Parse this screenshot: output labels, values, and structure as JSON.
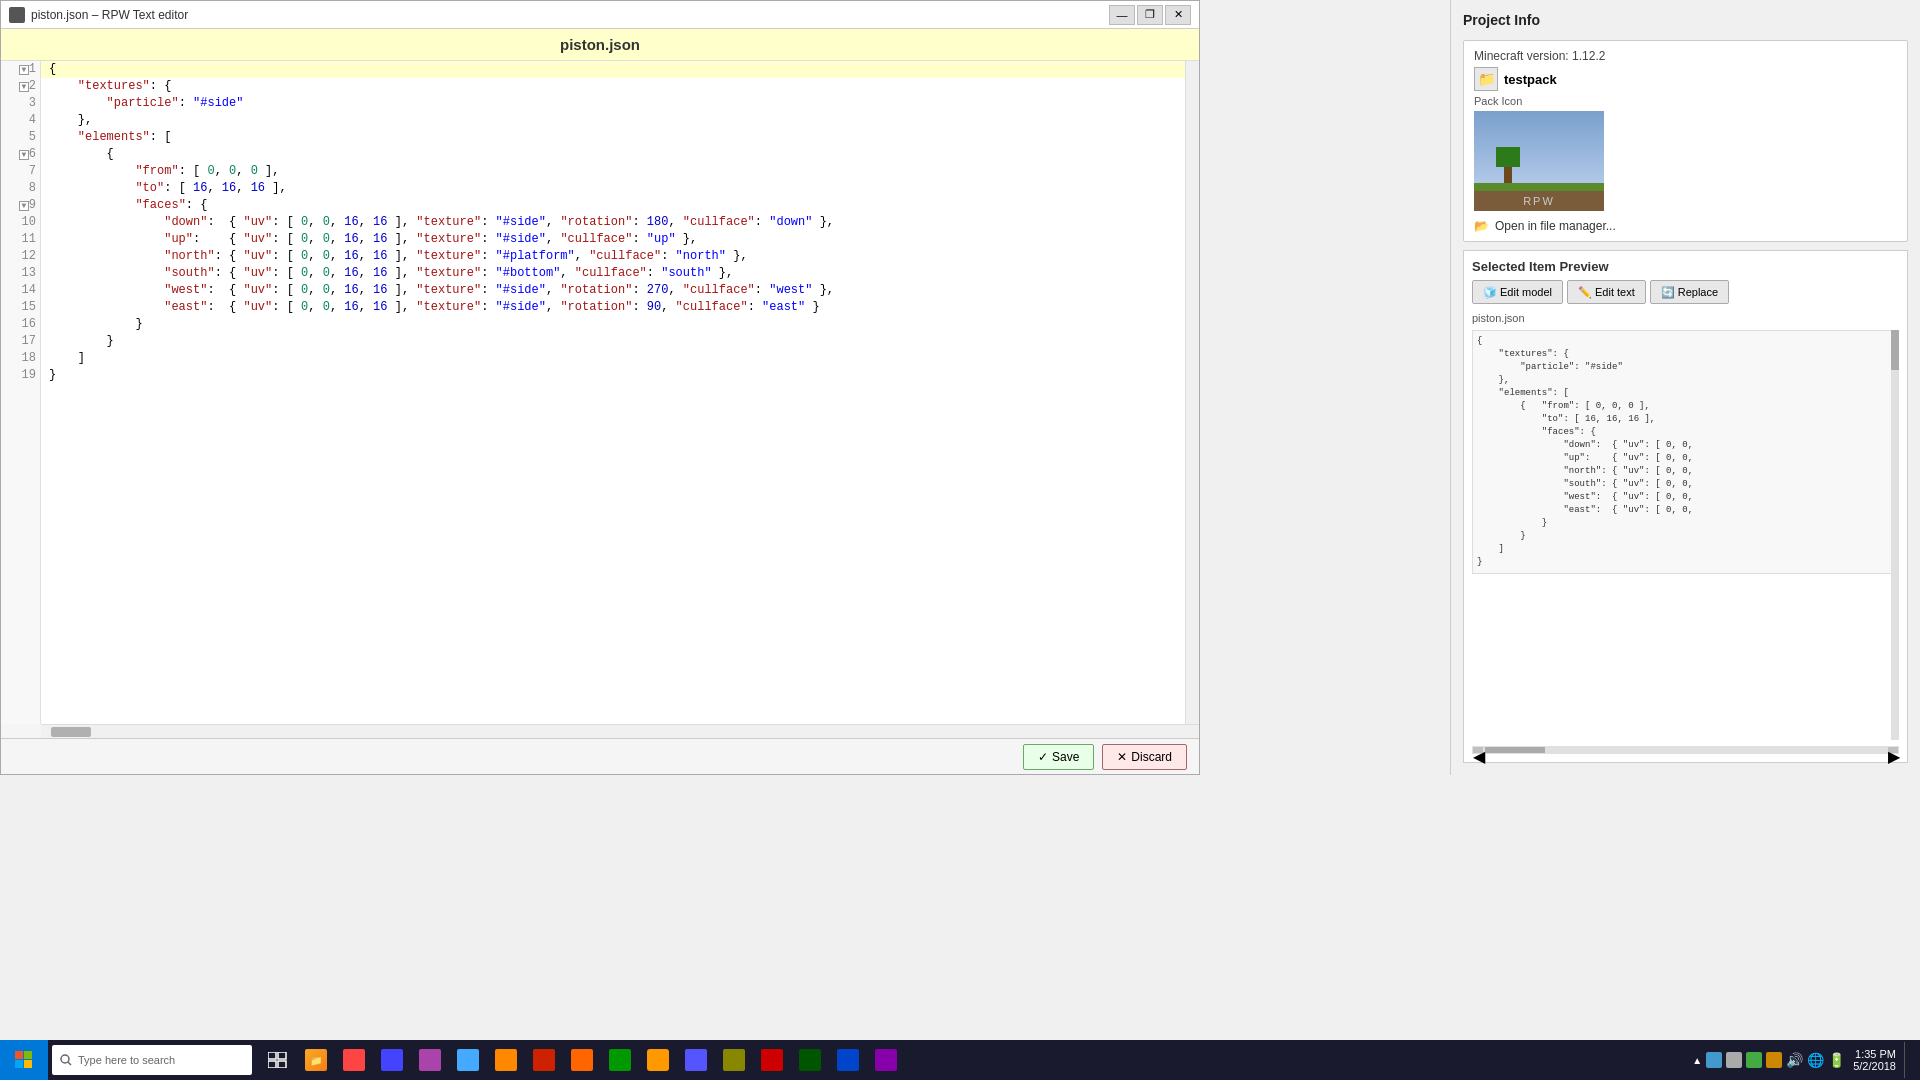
{
  "window": {
    "title": "piston.json – RPW Text editor",
    "file_title": "piston.json"
  },
  "titlebar": {
    "minimize": "—",
    "maximize": "❐",
    "close": "✕"
  },
  "editor": {
    "lines": [
      {
        "num": "1",
        "fold": true,
        "content": "{",
        "class": ""
      },
      {
        "num": "2",
        "fold": true,
        "indent": "    ",
        "content": "\"textures\": {",
        "class": ""
      },
      {
        "num": "3",
        "indent": "        ",
        "content": "\"particle\": \"#side\"",
        "class": ""
      },
      {
        "num": "4",
        "indent": "    ",
        "content": "},",
        "class": ""
      },
      {
        "num": "5",
        "indent": "    ",
        "content": "\"elements\": [",
        "class": ""
      },
      {
        "num": "6",
        "fold": true,
        "indent": "    ",
        "content": "    {",
        "class": ""
      },
      {
        "num": "7",
        "indent": "        ",
        "content": "\"from\": [ 0, 0, 0 ],",
        "class": ""
      },
      {
        "num": "8",
        "indent": "        ",
        "content": "\"to\": [ 16, 16, 16 ],",
        "class": ""
      },
      {
        "num": "9",
        "fold": true,
        "indent": "        ",
        "content": "\"faces\": {",
        "class": ""
      },
      {
        "num": "10",
        "indent": "            ",
        "content": "\"down\":  { \"uv\": [ 0, 0, 16, 16 ], \"texture\": \"#side\", \"rotation\": 180, \"cullface\": \"down\" },",
        "class": ""
      },
      {
        "num": "11",
        "indent": "            ",
        "content": "\"up\":    { \"uv\": [ 0, 0, 16, 16 ], \"texture\": \"#side\", \"cullface\": \"up\" },",
        "class": ""
      },
      {
        "num": "12",
        "indent": "            ",
        "content": "\"north\": { \"uv\": [ 0, 0, 16, 16 ], \"texture\": \"#platform\", \"cullface\": \"north\" },",
        "class": ""
      },
      {
        "num": "13",
        "indent": "            ",
        "content": "\"south\": { \"uv\": [ 0, 0, 16, 16 ], \"texture\": \"#bottom\", \"cullface\": \"south\" },",
        "class": ""
      },
      {
        "num": "14",
        "indent": "            ",
        "content": "\"west\":  { \"uv\": [ 0, 0, 16, 16 ], \"texture\": \"#side\", \"rotation\": 270, \"cullface\": \"west\" },",
        "class": ""
      },
      {
        "num": "15",
        "indent": "            ",
        "content": "\"east\":  { \"uv\": [ 0, 0, 16, 16 ], \"texture\": \"#side\", \"rotation\": 90, \"cullface\": \"east\" }",
        "class": ""
      },
      {
        "num": "16",
        "indent": "        ",
        "content": "}",
        "class": ""
      },
      {
        "num": "17",
        "indent": "    ",
        "content": "}",
        "class": ""
      },
      {
        "num": "18",
        "indent": "",
        "content": "]",
        "class": ""
      },
      {
        "num": "19",
        "indent": "",
        "content": "}",
        "class": ""
      }
    ]
  },
  "buttons": {
    "save": "Save",
    "discard": "Discard"
  },
  "right_panel": {
    "project_info_title": "Project Info",
    "mc_version_label": "Minecraft version: 1.12.2",
    "pack_name": "testpack",
    "pack_icon_label": "Pack Icon",
    "open_file_manager": "Open in file manager...",
    "selected_item_preview_title": "Selected Item Preview",
    "edit_model_label": "Edit model",
    "edit_text_label": "Edit text",
    "replace_label": "Replace",
    "preview_filename": "piston.json",
    "preview_code_lines": [
      "{",
      "    \"textures\": {",
      "        \"particle\": \"#side\"",
      "    },",
      "    \"elements\": [",
      "        {   \"from\": [ 0, 0, 0 ],",
      "            \"to\": [ 16, 16, 16 ],",
      "            \"faces\": {",
      "                \"down\":  { \"uv\": [ 0, 0,",
      "                \"up\":    { \"uv\": [ 0, 0,",
      "                \"north\": { \"uv\": [ 0, 0,",
      "                \"south\": { \"uv\": [ 0, 0,",
      "                \"west\":  { \"uv\": [ 0, 0,",
      "                \"east\":  { \"uv\": [ 0, 0,",
      "            }",
      "        }",
      "    ]",
      "}"
    ]
  },
  "taskbar": {
    "search_placeholder": "Type here to search",
    "time": "1:35 PM",
    "date": "5/2/2018"
  }
}
